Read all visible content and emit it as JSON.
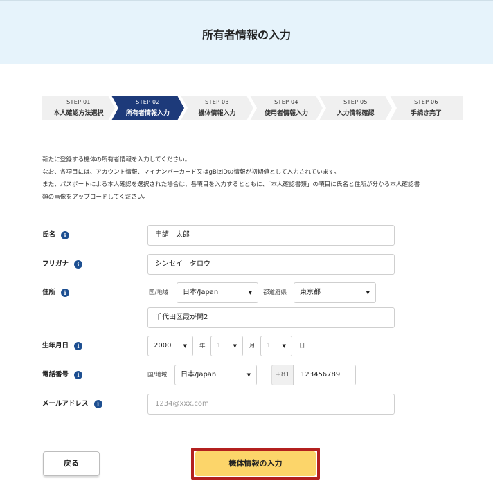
{
  "page": {
    "title": "所有者情報の入力"
  },
  "steps": [
    {
      "num": "STEP 01",
      "name": "本人確認方法選択"
    },
    {
      "num": "STEP 02",
      "name": "所有者情報入力"
    },
    {
      "num": "STEP 03",
      "name": "機体情報入力"
    },
    {
      "num": "STEP 04",
      "name": "使用者情報入力"
    },
    {
      "num": "STEP 05",
      "name": "入力情報確認"
    },
    {
      "num": "STEP 06",
      "name": "手続き完了"
    }
  ],
  "active_step_index": 1,
  "intro": {
    "line1": "新たに登録する機体の所有者情報を入力してください。",
    "line2": "なお、各項目には、アカウント情報、マイナンバーカード又はgBizIDの情報が初期値として入力されています。",
    "line3": "また、パスポートによる本人確認を選択された場合は、各項目を入力するとともに、「本人確認書類」の項目に氏名と住所が分かる本人確認書",
    "line4": "類の画像をアップロードしてください。"
  },
  "form": {
    "name": {
      "label": "氏名",
      "value": "申請　太郎"
    },
    "furigana": {
      "label": "フリガナ",
      "value": "シンセイ　タロウ"
    },
    "address": {
      "label": "住所",
      "country_label": "国/地域",
      "country_value": "日本/Japan",
      "prefecture_label": "都道府県",
      "prefecture_value": "東京都",
      "street_value": "千代田区霞が関2"
    },
    "birthdate": {
      "label": "生年月日",
      "year_value": "2000",
      "year_unit": "年",
      "month_value": "1",
      "month_unit": "月",
      "day_value": "1",
      "day_unit": "日"
    },
    "phone": {
      "label": "電話番号",
      "country_label": "国/地域",
      "country_value": "日本/Japan",
      "prefix": "+81",
      "value": "123456789"
    },
    "email": {
      "label": "メールアドレス",
      "placeholder": "1234@xxx.com"
    }
  },
  "icons": {
    "info": "i",
    "caret": "▼"
  },
  "buttons": {
    "back_label": "戻る",
    "next_label": "機体情報の入力"
  },
  "colors": {
    "header_bg": "#e6f3fb",
    "step_active": "#1d3a7a",
    "step_inactive": "#f0f0f0",
    "info_icon": "#1d4f91",
    "next_button": "#fcd56a",
    "highlight_outline": "#b3201f"
  }
}
